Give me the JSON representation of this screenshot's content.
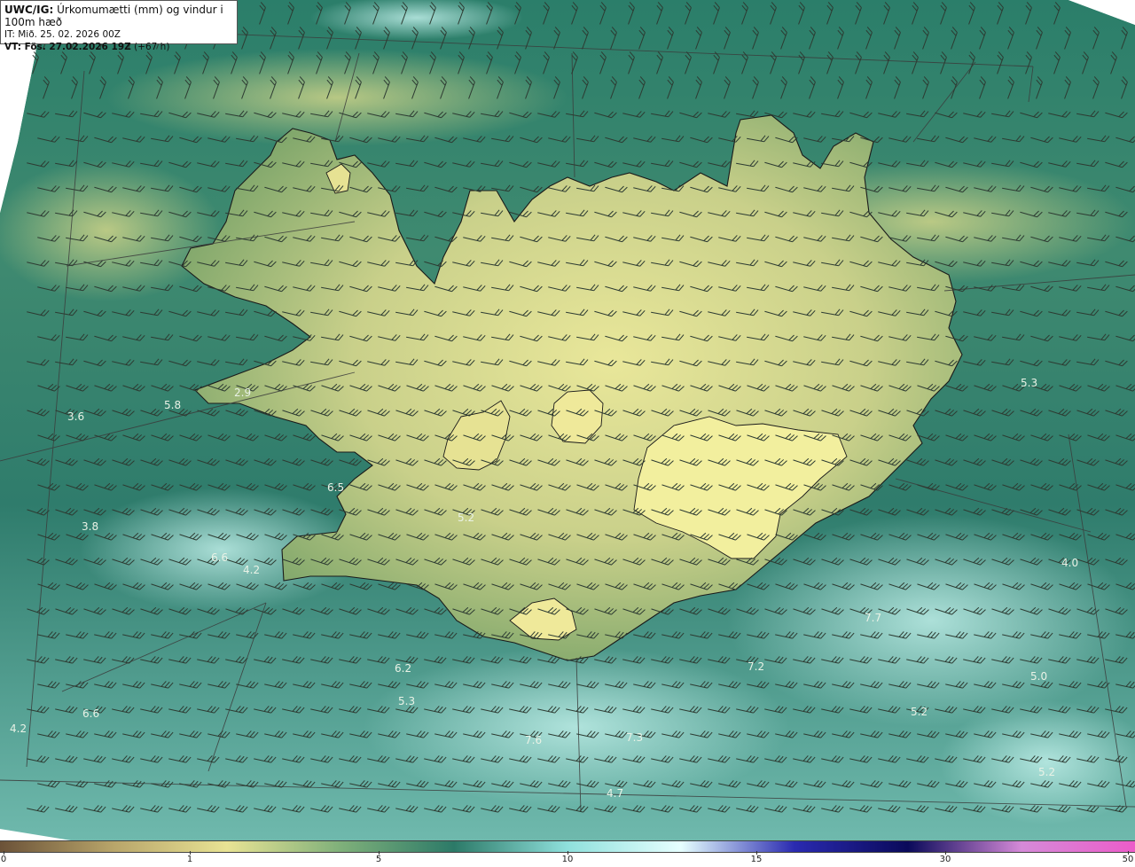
{
  "header": {
    "model": "UWC/IG:",
    "product": " Úrkomumætti (mm) og vindur i 100m hæð",
    "init_time": "IT: Mið. 25. 02. 2026 00Z",
    "valid_prefix": "VT:",
    "valid_time": " Fös. 27.02.2026 19Z",
    "lead": " (+67 h)"
  },
  "colors": {
    "sea_dark": "#1f6b5e",
    "sea_mid": "#3f8a78",
    "sea_light": "#8fd0c6",
    "land_low": "#7da56a",
    "land_high": "#e9e79a",
    "coast": "#1a1a1a",
    "grid": "#3b3b3b"
  },
  "value_labels": [
    {
      "text": "2.9"
    },
    {
      "text": "5.8"
    },
    {
      "text": "3.6"
    },
    {
      "text": "6.5"
    },
    {
      "text": "5.2"
    },
    {
      "text": "3.8"
    },
    {
      "text": "6.6"
    },
    {
      "text": "4.2"
    },
    {
      "text": "5.3"
    },
    {
      "text": "4.0"
    },
    {
      "text": "7.7"
    },
    {
      "text": "7.2"
    },
    {
      "text": "5.0"
    },
    {
      "text": "6.2"
    },
    {
      "text": "5.3"
    },
    {
      "text": "6.6"
    },
    {
      "text": "4.2"
    },
    {
      "text": "7.6"
    },
    {
      "text": "7.3"
    },
    {
      "text": "5.2"
    },
    {
      "text": "5.2"
    },
    {
      "text": "4.7"
    }
  ],
  "colorbar": {
    "ticks": [
      "0",
      "1",
      "5",
      "10",
      "15",
      "30",
      "50"
    ],
    "colors": [
      "#6b5238",
      "#b8a56a",
      "#e8e394",
      "#7fb07a",
      "#2c7a68",
      "#8fe0dc",
      "#e6ffff",
      "#2a2ab0",
      "#0a0a5a",
      "#d58ad8",
      "#ec5cc9"
    ]
  },
  "wind_barbs": "barb-icon"
}
